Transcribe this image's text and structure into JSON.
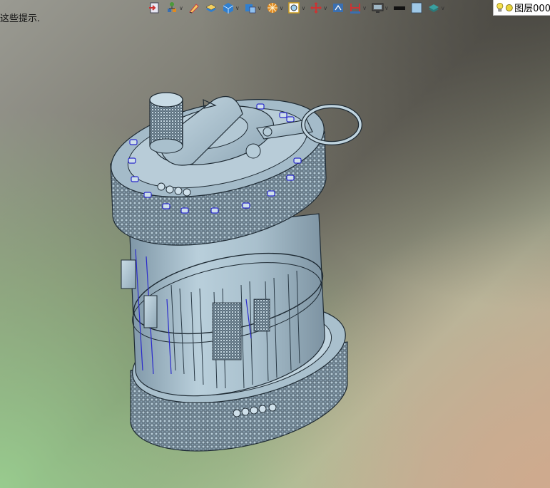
{
  "hint_text": "这些提示.",
  "toolbar": {
    "tools": [
      {
        "name": "exit-icon",
        "color": "#cc3333",
        "dropdown": false
      },
      {
        "name": "tree-icon",
        "color": "#4a9a3a",
        "dropdown": true
      },
      {
        "name": "pencil-icon",
        "color": "#d04040",
        "dropdown": false
      },
      {
        "name": "stack-icon",
        "color": "#2f7fd0",
        "dropdown": false
      },
      {
        "name": "cube-icon",
        "color": "#2f7fd0",
        "dropdown": true
      },
      {
        "name": "view-cube-icon",
        "color": "#2f7fd0",
        "dropdown": true
      },
      {
        "name": "render-icon",
        "color": "#e08a20",
        "dropdown": true
      },
      {
        "name": "zoom-fit-icon",
        "color": "#d0a020",
        "dropdown": true
      },
      {
        "name": "pan-icon",
        "color": "#cc3333",
        "dropdown": true
      },
      {
        "name": "view-icon",
        "color": "#3a6fb0",
        "dropdown": false
      },
      {
        "name": "section-icon",
        "color": "#cc3333",
        "dropdown": true
      },
      {
        "name": "display-icon",
        "color": "#555555",
        "dropdown": true
      },
      {
        "name": "line-style-icon",
        "color": "#111111",
        "dropdown": false
      },
      {
        "name": "background-icon",
        "color": "#9fc9e8",
        "dropdown": false
      },
      {
        "name": "layer-icon",
        "color": "#39a0a0",
        "dropdown": true
      }
    ]
  },
  "layer": {
    "name": "图层000",
    "bulb_color": "#f5e050",
    "status_color": "#e8d43a"
  },
  "colors": {
    "model_body": "#9fb7c6",
    "model_edge": "#1e2a33",
    "highlight": "#2a2acc"
  }
}
